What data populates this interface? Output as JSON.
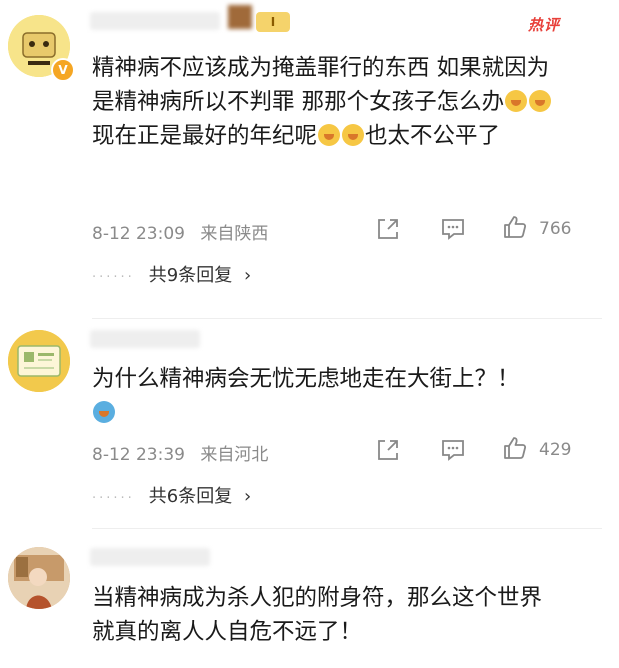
{
  "header": {
    "level_badge": "I",
    "hot_label": "热评"
  },
  "comments": [
    {
      "text": "精神病不应该成为掩盖罪行的东西 如果就因为是精神病所以不判罪 那那个女孩子怎么办",
      "text_tail": "现在正是最好的年纪呢",
      "text_end": "也太不公平了",
      "time": "8-12 23:09",
      "location": "来自陕西",
      "likes": "766",
      "replies": "共9条回复",
      "replies_arrow": "›"
    },
    {
      "text": "为什么精神病会无忧无虑地走在大街上？！",
      "time": "8-12 23:39",
      "location": "来自河北",
      "likes": "429",
      "replies": "共6条回复",
      "replies_arrow": "›"
    },
    {
      "text": "当精神病成为杀人犯的附身符，那么这个世界就真的离人人自危不远了！"
    }
  ],
  "icons": {
    "share": "share-icon",
    "comment": "comment-icon",
    "like": "thumbs-up-icon",
    "emoji": "smiley-emoji"
  }
}
